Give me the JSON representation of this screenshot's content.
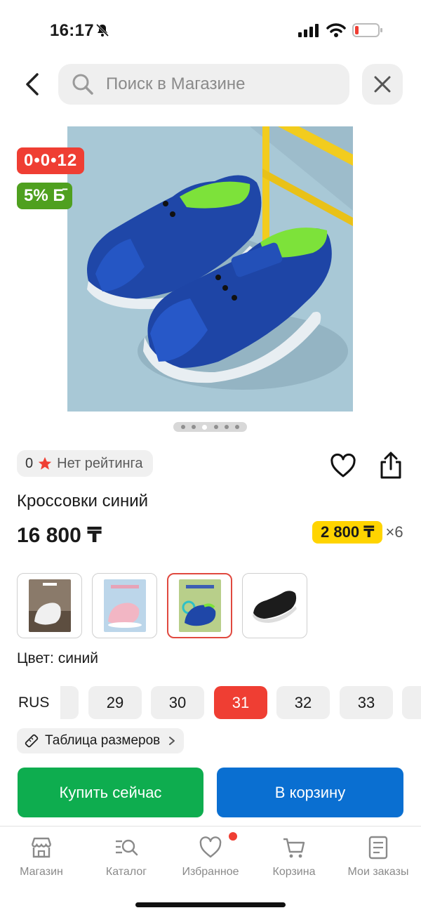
{
  "status_bar": {
    "time": "16:17"
  },
  "search": {
    "placeholder": "Поиск в Магазине"
  },
  "product": {
    "timer_badge": "0•0•12",
    "bonus_badge": "5% Б̄",
    "image_dots": 6,
    "active_dot": 3,
    "rating_count": "0",
    "rating_text": "Нет рейтинга",
    "title": "Кроссовки синий",
    "price": "16 800 ₸",
    "installment_amount": "2 800 ₸",
    "installment_mult": "×6",
    "color_label": "Цвет: синий"
  },
  "variants": [
    {
      "name": "variant-white",
      "selected": false
    },
    {
      "name": "variant-pink",
      "selected": false
    },
    {
      "name": "variant-blue",
      "selected": true
    },
    {
      "name": "variant-black",
      "selected": false
    }
  ],
  "sizes": {
    "system": "RUS",
    "items": [
      "29",
      "30",
      "31",
      "32",
      "33"
    ],
    "selected": "31"
  },
  "size_table_label": "Таблица размеров",
  "actions": {
    "buy_now": "Купить сейчас",
    "to_cart": "В корзину"
  },
  "bottom_nav": [
    {
      "label": "Магазин",
      "icon": "store-icon"
    },
    {
      "label": "Каталог",
      "icon": "catalog-search-icon"
    },
    {
      "label": "Избранное",
      "icon": "heart-icon"
    },
    {
      "label": "Корзина",
      "icon": "cart-icon"
    },
    {
      "label": "Мои заказы",
      "icon": "orders-icon"
    }
  ],
  "colors": {
    "accent_red": "#ef3e33",
    "green": "#0ead4f",
    "blue": "#0a6fd1",
    "yellow": "#ffd400",
    "bonus_green": "#4fa01f"
  }
}
